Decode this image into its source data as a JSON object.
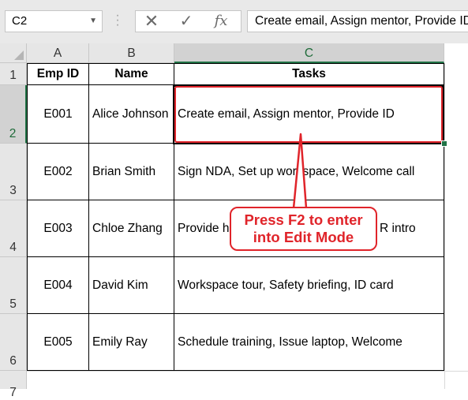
{
  "formula_bar": {
    "name_box": "C2",
    "cancel_glyph": "✕",
    "enter_glyph": "✓",
    "fx_label": "fx",
    "formula_text": "Create email, Assign mentor, Provide ID"
  },
  "columns": [
    "A",
    "B",
    "C"
  ],
  "rows": [
    "1",
    "2",
    "3",
    "4",
    "5",
    "6",
    "7"
  ],
  "headers": {
    "emp_id": "Emp ID",
    "name": "Name",
    "tasks": "Tasks"
  },
  "employees": [
    {
      "emp_id": "E001",
      "name": "Alice Johnson",
      "tasks": "Create email, Assign mentor, Provide ID"
    },
    {
      "emp_id": "E002",
      "name": "Brian Smith",
      "tasks": "Sign NDA, Set up workspace, Welcome call"
    },
    {
      "emp_id": "E003",
      "name": "Chloe Zhang",
      "tasks": "Provide h…R intro"
    },
    {
      "emp_id": "E004",
      "name": "David Kim",
      "tasks": "Workspace tour, Safety briefing, ID card"
    },
    {
      "emp_id": "E005",
      "name": "Emily Ray",
      "tasks": "Schedule training, Issue laptop, Welcome"
    }
  ],
  "callout": {
    "line1": "Press F2 to enter",
    "line2": "into Edit Mode"
  },
  "colors": {
    "accent_green": "#217346",
    "callout_red": "#e0242a"
  }
}
